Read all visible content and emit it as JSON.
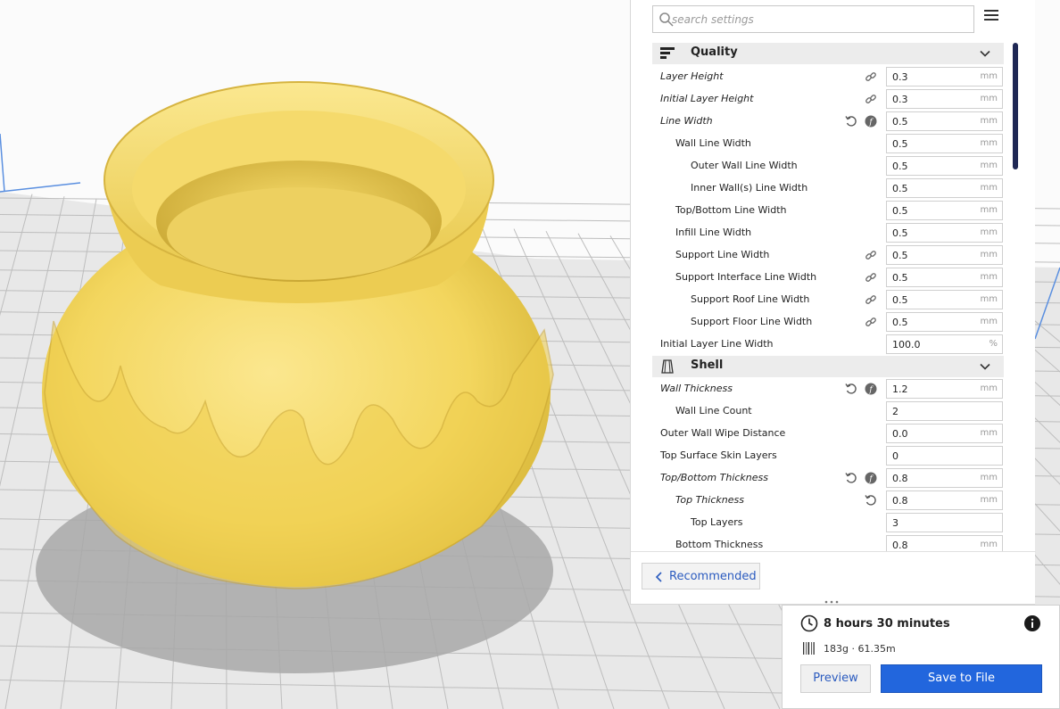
{
  "search": {
    "placeholder": "search settings"
  },
  "categories": [
    {
      "label": "Quality",
      "icon": "quality-icon"
    },
    {
      "label": "Shell",
      "icon": "shell-icon"
    }
  ],
  "quality_settings": [
    {
      "label": "Layer Height",
      "value": "0.3",
      "unit": "mm",
      "italic": true,
      "icons": [
        "link-icon"
      ]
    },
    {
      "label": "Initial Layer Height",
      "value": "0.3",
      "unit": "mm",
      "italic": true,
      "icons": [
        "link-icon"
      ]
    },
    {
      "label": "Line Width",
      "value": "0.5",
      "unit": "mm",
      "italic": true,
      "icons": [
        "reset-icon",
        "function-icon"
      ]
    },
    {
      "label": "Wall Line Width",
      "value": "0.5",
      "unit": "mm"
    },
    {
      "label": "Outer Wall Line Width",
      "value": "0.5",
      "unit": "mm"
    },
    {
      "label": "Inner Wall(s) Line Width",
      "value": "0.5",
      "unit": "mm"
    },
    {
      "label": "Top/Bottom Line Width",
      "value": "0.5",
      "unit": "mm"
    },
    {
      "label": "Infill Line Width",
      "value": "0.5",
      "unit": "mm"
    },
    {
      "label": "Support Line Width",
      "value": "0.5",
      "unit": "mm",
      "icons": [
        "link-icon"
      ]
    },
    {
      "label": "Support Interface Line Width",
      "value": "0.5",
      "unit": "mm",
      "icons": [
        "link-icon"
      ]
    },
    {
      "label": "Support Roof Line Width",
      "value": "0.5",
      "unit": "mm",
      "icons": [
        "link-icon"
      ]
    },
    {
      "label": "Support Floor Line Width",
      "value": "0.5",
      "unit": "mm",
      "icons": [
        "link-icon"
      ]
    },
    {
      "label": "Initial Layer Line Width",
      "value": "100.0",
      "unit": "%"
    }
  ],
  "shell_settings": [
    {
      "label": "Wall Thickness",
      "value": "1.2",
      "unit": "mm",
      "italic": true,
      "icons": [
        "reset-icon",
        "function-icon"
      ]
    },
    {
      "label": "Wall Line Count",
      "value": "2",
      "unit": ""
    },
    {
      "label": "Outer Wall Wipe Distance",
      "value": "0.0",
      "unit": "mm"
    },
    {
      "label": "Top Surface Skin Layers",
      "value": "0",
      "unit": ""
    },
    {
      "label": "Top/Bottom Thickness",
      "value": "0.8",
      "unit": "mm",
      "italic": true,
      "icons": [
        "reset-icon",
        "function-icon"
      ]
    },
    {
      "label": "Top Thickness",
      "value": "0.8",
      "unit": "mm",
      "italic": true,
      "icons": [
        "reset-icon"
      ]
    },
    {
      "label": "Top Layers",
      "value": "3",
      "unit": ""
    },
    {
      "label": "Bottom Thickness",
      "value": "0.8",
      "unit": "mm"
    }
  ],
  "recommended": {
    "label": "Recommended"
  },
  "summary": {
    "time": "8 hours 30 minutes",
    "material": "183g · 61.35m",
    "preview_label": "Preview",
    "save_label": "Save to File"
  },
  "colors": {
    "accent": "#2266dd",
    "scrollbar": "#1f2855",
    "model": "#f7dc6f",
    "category_bg": "#ececec"
  }
}
